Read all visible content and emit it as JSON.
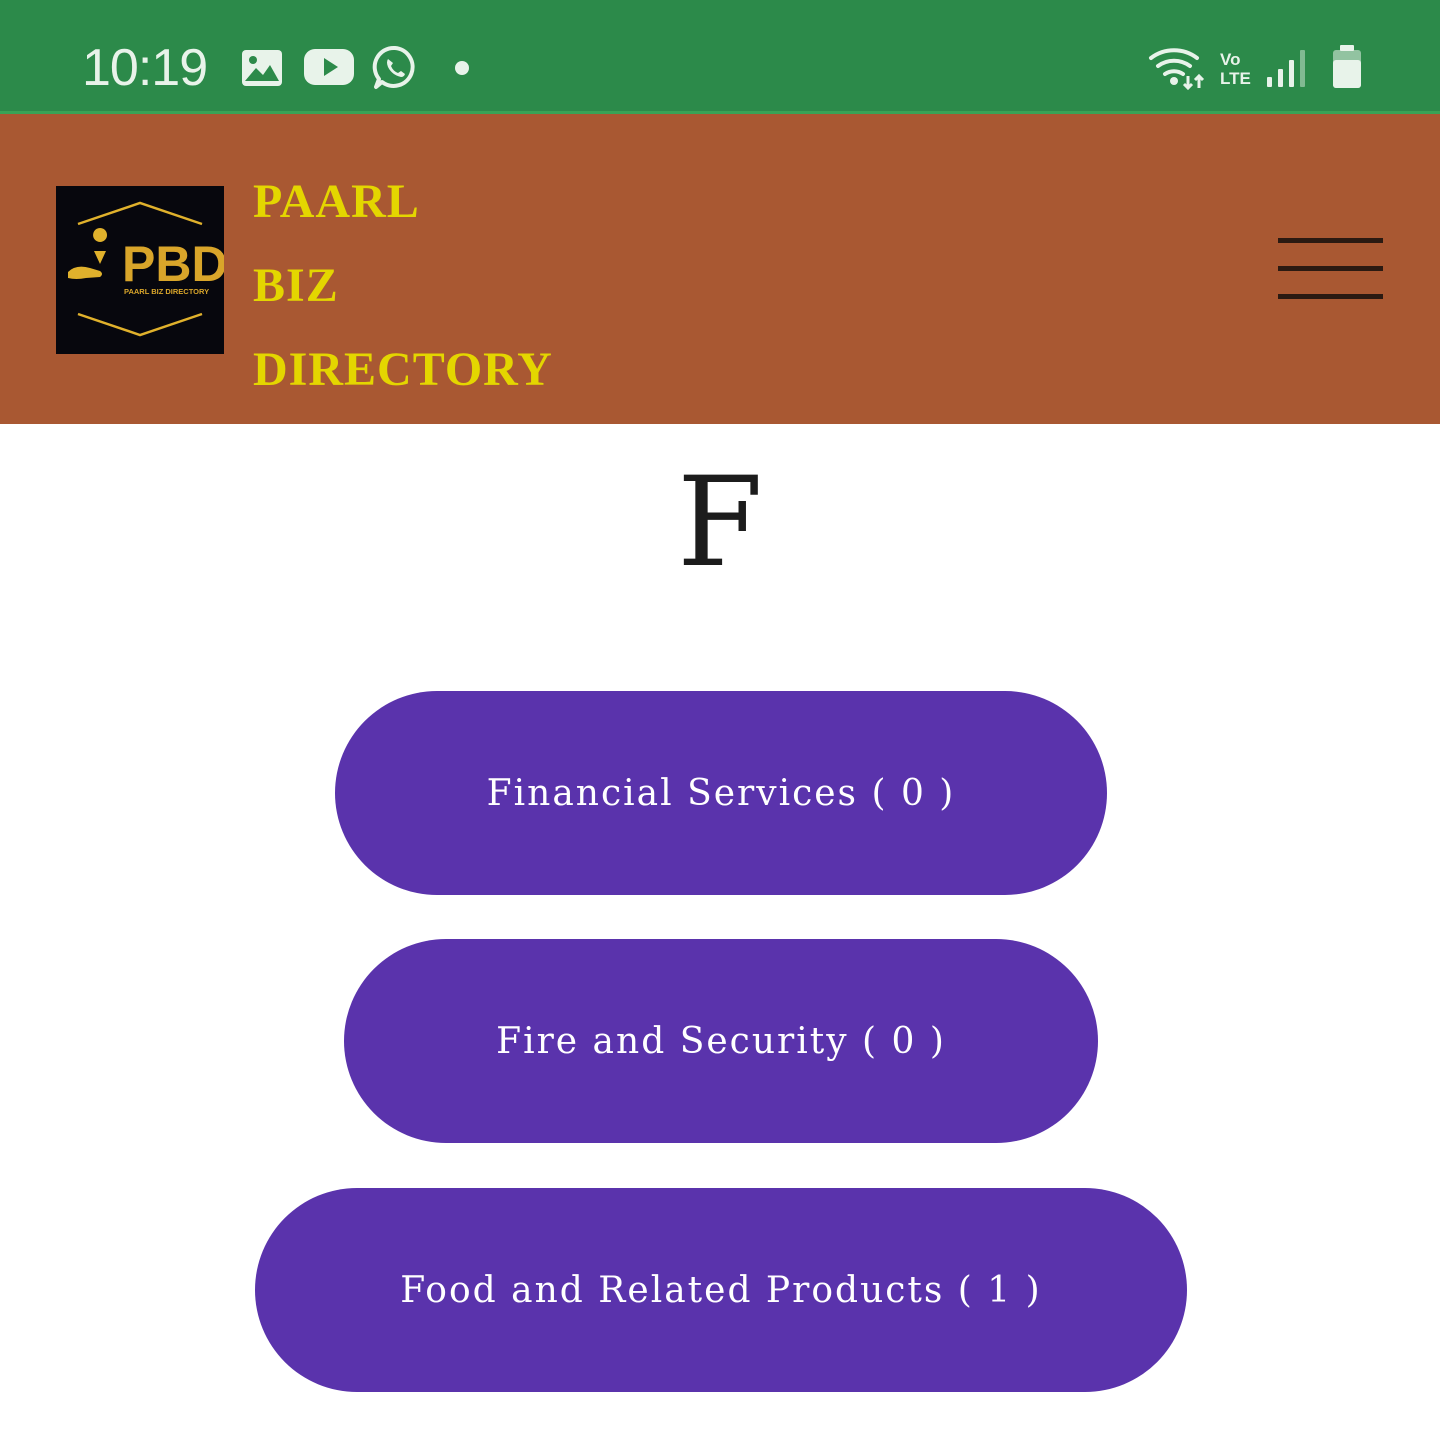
{
  "status_bar": {
    "time": "10:19",
    "left_icons": [
      "gallery-icon",
      "youtube-icon",
      "whatsapp-icon",
      "notification-dot-icon"
    ],
    "right_icons": [
      "wifi-icon",
      "volte-icon",
      "signal-icon",
      "battery-icon"
    ],
    "volte_top": "Vo",
    "volte_bottom": "LTE"
  },
  "header": {
    "logo_text": "PBD",
    "logo_subtext": "PAARL BIZ DIRECTORY",
    "title_lines": [
      "PAARL",
      "BIZ",
      "DIRECTORY"
    ],
    "menu_icon": "hamburger-icon"
  },
  "main": {
    "letter": "F",
    "categories": [
      {
        "label": "Financial Services ( 0 )"
      },
      {
        "label": "Fire and Security ( 0 )"
      },
      {
        "label": "Food and Related Products ( 1 )"
      }
    ]
  },
  "colors": {
    "status_bar": "#2c8a4a",
    "header": "#a95832",
    "title": "#e4d600",
    "button": "#5a33ac",
    "logo_gold": "#d9a52a"
  }
}
